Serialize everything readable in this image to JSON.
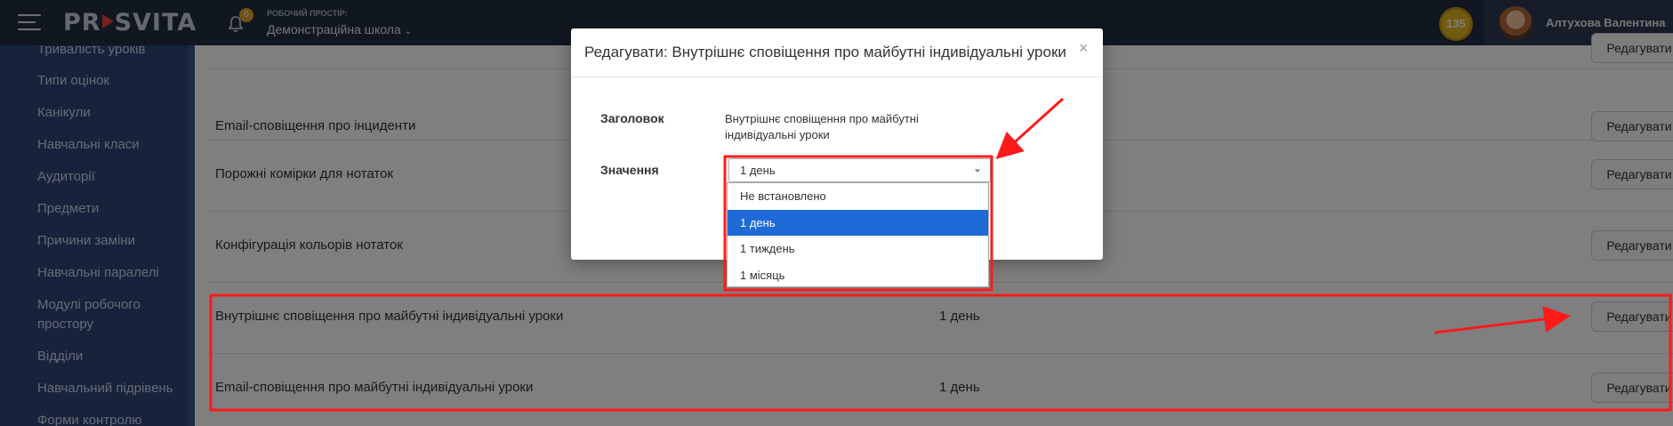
{
  "topbar": {
    "logo": "PRSVITA",
    "logo_parts": [
      "PR",
      "SVITA"
    ],
    "notification_count": "0",
    "workspace_label": "РОБОЧИЙ ПРОСТІР:",
    "workspace_name": "Демонстраційна школа",
    "coins": "135",
    "user_name": "Алтухова Валентина"
  },
  "sidebar": {
    "items": [
      {
        "label": "Тривалість уроків"
      },
      {
        "label": "Типи оцінок"
      },
      {
        "label": "Канікули"
      },
      {
        "label": "Навчальні класи"
      },
      {
        "label": "Аудиторії"
      },
      {
        "label": "Предмети"
      },
      {
        "label": "Причини заміни"
      },
      {
        "label": "Навчальні паралелі"
      },
      {
        "label": "Модулі робочого простору"
      },
      {
        "label": "Відділи"
      },
      {
        "label": "Навчальний підрівень"
      },
      {
        "label": "Форми контролю"
      }
    ]
  },
  "settings": {
    "edit_label": "Редагувати",
    "rows": [
      {
        "label": "Email-сповіщення про інциденти",
        "value": ""
      },
      {
        "label": "Порожні комірки для нотаток",
        "value": ""
      },
      {
        "label": "Конфігурація кольорів нотаток",
        "value": ""
      },
      {
        "label": "Внутрішнє сповіщення про майбутні індивідуальні уроки",
        "value": "1 день"
      },
      {
        "label": "Email-сповіщення про майбутні індивідуальні уроки",
        "value": "1 день"
      }
    ]
  },
  "modal": {
    "title": "Редагувати: Внутрішнє сповіщення про майбутні індивідуальні уроки",
    "close": "×",
    "heading_label": "Заголовок",
    "heading_value": "Внутрішнє сповіщення про майбутні індивідуальні уроки",
    "value_label": "Значення",
    "selected_value": "1 день",
    "options": [
      "Не встановлено",
      "1 день",
      "1 тиждень",
      "1 місяць"
    ],
    "selected_index": 1
  },
  "colors": {
    "annotation": "#ff1a1a",
    "selected_option": "#1e6bd8",
    "sidebar": "#2f4577",
    "topbar": "#232f42"
  }
}
